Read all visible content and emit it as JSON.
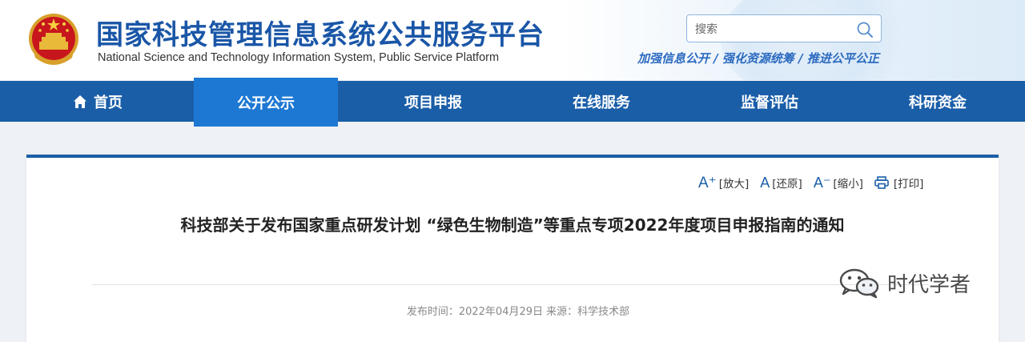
{
  "header": {
    "title": "国家科技管理信息系统公共服务平台",
    "subtitle": "National Science and Technology Information System, Public Service Platform",
    "slogan": "加强信息公开 / 强化资源统筹 / 推进公平公正",
    "search": {
      "placeholder": "搜索",
      "value": ""
    }
  },
  "nav": {
    "items": [
      {
        "label": "首页",
        "icon": "home-icon",
        "active": false
      },
      {
        "label": "公开公示",
        "active": true
      },
      {
        "label": "项目申报",
        "active": false
      },
      {
        "label": "在线服务",
        "active": false
      },
      {
        "label": "监督评估",
        "active": false
      },
      {
        "label": "科研资金",
        "active": false
      }
    ]
  },
  "toolbar": {
    "zoom_in": {
      "icon": "font-increase-icon",
      "glyph": "A⁺",
      "label": "[放大]"
    },
    "reset": {
      "icon": "font-reset-icon",
      "glyph": "A",
      "label": "[还原]"
    },
    "zoom_out": {
      "icon": "font-decrease-icon",
      "glyph": "A⁻",
      "label": "[缩小]"
    },
    "print": {
      "icon": "printer-icon",
      "label": "[打印]"
    }
  },
  "article": {
    "title": "科技部关于发布国家重点研发计划 “绿色生物制造”等重点专项2022年度项目申报指南的通知",
    "meta": "发布时间：2022年04月29日 来源：科学技术部"
  },
  "watermark": {
    "icon": "wechat-icon",
    "text": "时代学者"
  },
  "colors": {
    "primary": "#1a5ea8",
    "active_tab": "#1d78d3",
    "title_blue": "#1a56a7"
  }
}
